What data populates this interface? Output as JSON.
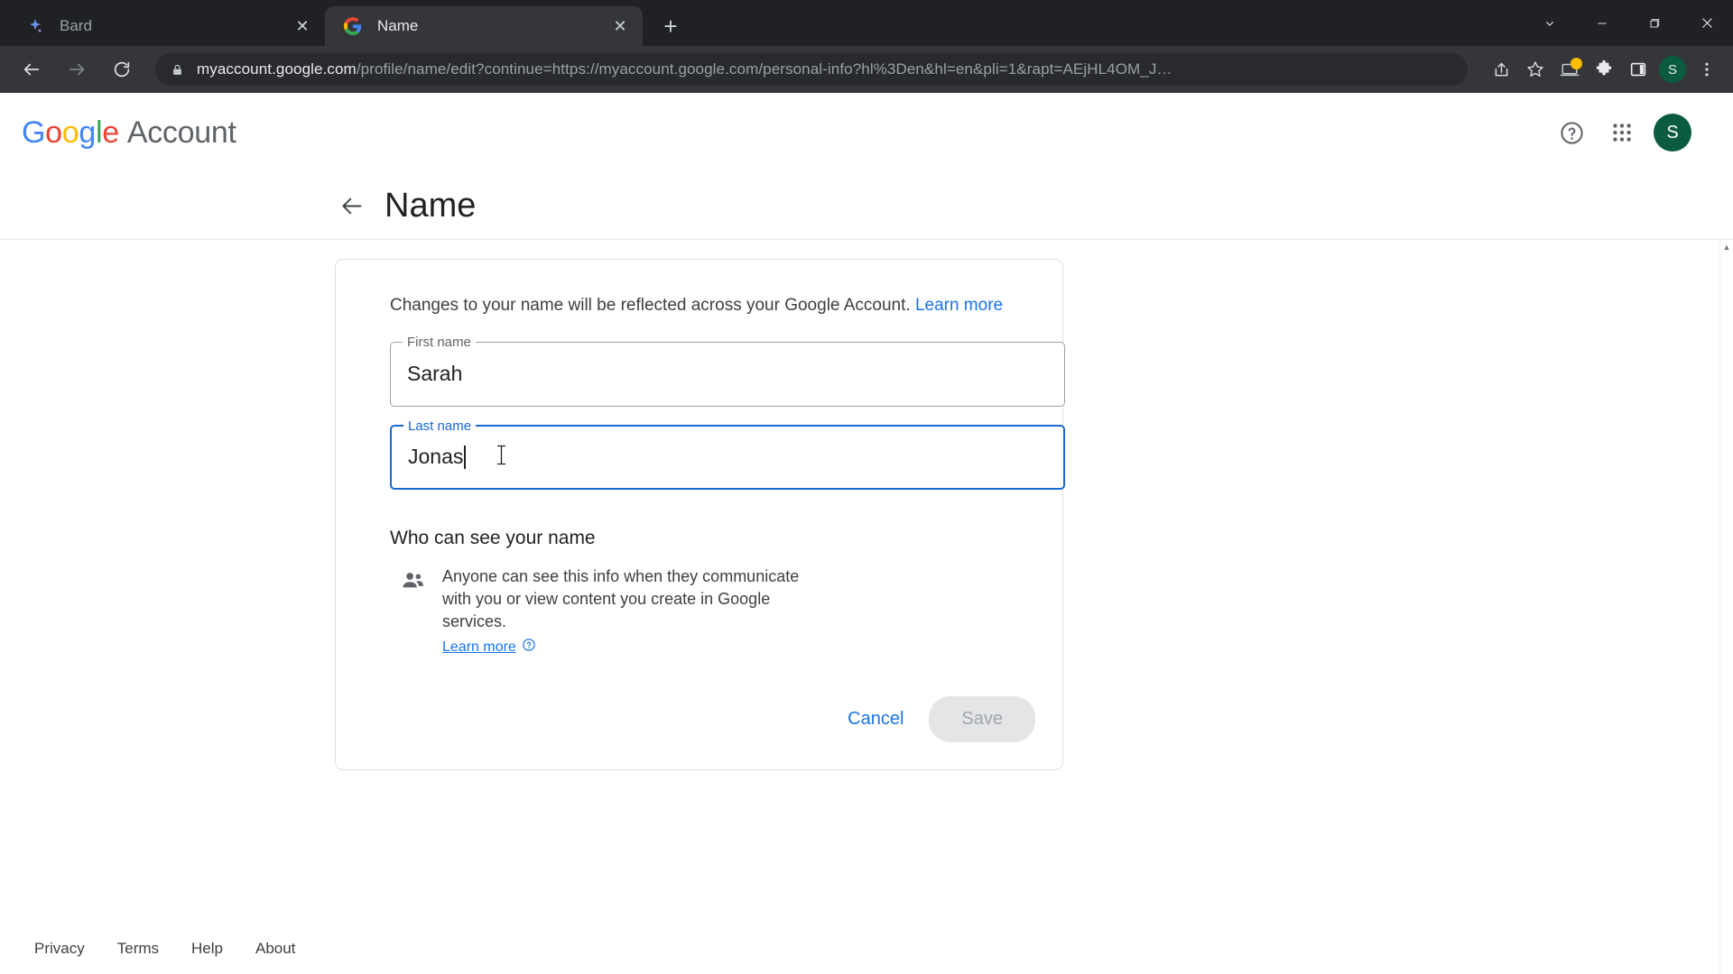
{
  "browser": {
    "tabs": [
      {
        "title": "Bard",
        "favicon": "bard-sparkle-icon",
        "active": false,
        "close_label": "✕"
      },
      {
        "title": "Name",
        "favicon": "google-g-icon",
        "active": true,
        "close_label": "✕"
      }
    ],
    "new_tab_label": "+",
    "window_controls": {
      "collapse": "⌄",
      "minimize": "─",
      "maximize": "❐",
      "close": "✕"
    },
    "toolbar": {
      "back_label": "←",
      "forward_label": "→",
      "reload_label": "↻",
      "security_icon": "lock-icon",
      "url_domain": "myaccount.google.com",
      "url_path": "/profile/name/edit?continue=https://myaccount.google.com/personal-info?hl%3Den&hl=en&pli=1&rapt=AEjHL4OM_J…",
      "share_icon": "share-icon",
      "bookmark_icon": "star-icon",
      "update_icon": "update-laptop-icon",
      "extensions_icon": "puzzle-icon",
      "sidepanel_icon": "side-panel-icon",
      "profile_initial": "S",
      "menu_icon": "three-dot-menu-icon"
    }
  },
  "header": {
    "logo_letters": [
      "G",
      "o",
      "o",
      "g",
      "l",
      "e"
    ],
    "logo_word": "Account",
    "help_icon": "help-circle-icon",
    "apps_icon": "apps-grid-icon",
    "avatar_initial": "S"
  },
  "title_bar": {
    "back_icon": "back-arrow-icon",
    "title": "Name"
  },
  "card": {
    "description": "Changes to your name will be reflected across your Google Account.",
    "description_link": "Learn more",
    "fields": [
      {
        "label": "First name",
        "value": "Sarah",
        "focused": false
      },
      {
        "label": "Last name",
        "value": "Jonas",
        "focused": true
      }
    ],
    "privacy": {
      "heading": "Who can see your name",
      "icon": "people-icon",
      "text": "Anyone can see this info when they communicate with you or view content you create in Google services.",
      "link": "Learn more",
      "link_icon": "help-circle-icon"
    },
    "actions": {
      "cancel_label": "Cancel",
      "save_label": "Save",
      "save_disabled": true
    }
  },
  "footer": {
    "links": [
      "Privacy",
      "Terms",
      "Help",
      "About"
    ]
  },
  "colors": {
    "accent_blue": "#1a73e8",
    "focus_blue": "#1967d2",
    "chrome_dark": "#202124",
    "toolbar_dark": "#35363a",
    "avatar_green": "#0b5c3e",
    "badge_yellow": "#fbbc04"
  }
}
